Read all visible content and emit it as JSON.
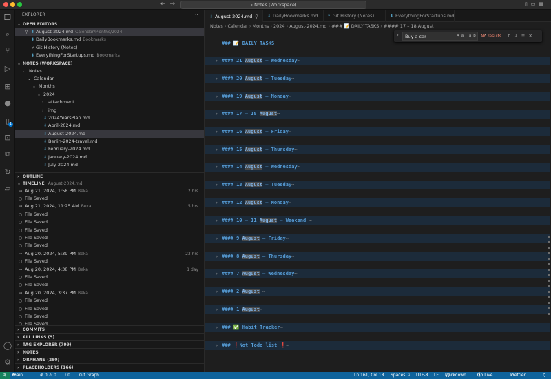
{
  "window": {
    "title": "Notes (Workspace)"
  },
  "explorer": {
    "title": "EXPLORER",
    "open_editors": {
      "label": "OPEN EDITORS",
      "items": [
        {
          "name": "August-2024.md",
          "desc": "Calendar/Months/2024"
        },
        {
          "name": "DailyBookmarks.md",
          "desc": "Bookmarks"
        },
        {
          "name": "Git History (Notes)",
          "desc": ""
        },
        {
          "name": "EverythingForStartups.md",
          "desc": "Bookmarks"
        }
      ]
    },
    "workspace": {
      "label": "NOTES (WORKSPACE)",
      "tree": [
        {
          "name": "Notes",
          "indent": 1,
          "kind": "folder-open"
        },
        {
          "name": "Calendar",
          "indent": 2,
          "kind": "folder-open"
        },
        {
          "name": "Months",
          "indent": 3,
          "kind": "folder-open"
        },
        {
          "name": "2024",
          "indent": 4,
          "kind": "folder-open"
        },
        {
          "name": "attachment",
          "indent": 5,
          "kind": "folder"
        },
        {
          "name": "img",
          "indent": 5,
          "kind": "folder"
        },
        {
          "name": "2024YearsPlan.md",
          "indent": 5,
          "kind": "file"
        },
        {
          "name": "April-2024.md",
          "indent": 5,
          "kind": "file"
        },
        {
          "name": "August-2024.md",
          "indent": 5,
          "kind": "file",
          "selected": true
        },
        {
          "name": "Berlin-2024-travel.md",
          "indent": 5,
          "kind": "file"
        },
        {
          "name": "February-2024.md",
          "indent": 5,
          "kind": "file"
        },
        {
          "name": "January-2024.md",
          "indent": 5,
          "kind": "file"
        },
        {
          "name": "July-2024.md",
          "indent": 5,
          "kind": "file"
        }
      ]
    },
    "outline_label": "OUTLINE",
    "timeline": {
      "label": "TIMELINE",
      "file": "August-2024.md",
      "items": [
        {
          "text": "Aug 21, 2024, 1:58 PM",
          "who": "Beka",
          "ago": "2 hrs",
          "commit": true
        },
        {
          "text": "File Saved",
          "who": "",
          "ago": "",
          "commit": false
        },
        {
          "text": "Aug 21, 2024, 11:25 AM",
          "who": "Beka",
          "ago": "5 hrs",
          "commit": true
        },
        {
          "text": "File Saved",
          "who": "",
          "ago": "",
          "commit": false
        },
        {
          "text": "File Saved",
          "who": "",
          "ago": "",
          "commit": false
        },
        {
          "text": "File Saved",
          "who": "",
          "ago": "",
          "commit": false
        },
        {
          "text": "File Saved",
          "who": "",
          "ago": "",
          "commit": false
        },
        {
          "text": "File Saved",
          "who": "",
          "ago": "",
          "commit": false
        },
        {
          "text": "Aug 20, 2024, 5:39 PM",
          "who": "Beka",
          "ago": "23 hrs",
          "commit": true
        },
        {
          "text": "File Saved",
          "who": "",
          "ago": "",
          "commit": false
        },
        {
          "text": "Aug 20, 2024, 4:38 PM",
          "who": "Beka",
          "ago": "1 day",
          "commit": true
        },
        {
          "text": "File Saved",
          "who": "",
          "ago": "",
          "commit": false
        },
        {
          "text": "File Saved",
          "who": "",
          "ago": "",
          "commit": false
        },
        {
          "text": "Aug 20, 2024, 3:37 PM",
          "who": "Beka",
          "ago": "",
          "commit": true
        },
        {
          "text": "File Saved",
          "who": "",
          "ago": "",
          "commit": false
        },
        {
          "text": "File Saved",
          "who": "",
          "ago": "",
          "commit": false
        },
        {
          "text": "File Saved",
          "who": "",
          "ago": "",
          "commit": false
        },
        {
          "text": "File Saved",
          "who": "",
          "ago": "",
          "commit": false
        }
      ]
    },
    "bottom_sections": [
      "COMMITS",
      "ALL LINKS (5)",
      "TAG EXPLORER (799)",
      "NOTES",
      "ORPHANS (280)",
      "PLACEHOLDERS (166)"
    ]
  },
  "tabs": [
    {
      "label": "August-2024.md",
      "active": true,
      "pinned": true
    },
    {
      "label": "DailyBookmarks.md",
      "active": false
    },
    {
      "label": "Git History (Notes)",
      "active": false
    },
    {
      "label": "EverythingForStartups.md",
      "active": false
    }
  ],
  "breadcrumb": {
    "parts": [
      "Notes",
      "Calendar",
      "Months",
      "2024",
      "August-2024.md",
      "### 📝 DAILY TASKS",
      "#### 17 – 18 August"
    ]
  },
  "find": {
    "value": "Buy a car",
    "options": "Aa ab .*",
    "results": "No results"
  },
  "editor": {
    "lines": [
      {
        "kind": "h3",
        "pre": "### 📝 ",
        "hl": "",
        "post": "DAILY TASKS",
        "folded": false
      },
      {
        "kind": "h4",
        "pre": "#### 21 ",
        "hl": "August",
        "post": " – Wednesday",
        "folded": true
      },
      {
        "kind": "h4",
        "pre": "#### 20 ",
        "hl": "August",
        "post": " – Tuesday",
        "folded": true
      },
      {
        "kind": "h4",
        "pre": "#### 19 ",
        "hl": "August",
        "post": " – Monday",
        "folded": true
      },
      {
        "kind": "h4",
        "pre": "#### 17 – 18 ",
        "hl": "August",
        "post": "",
        "folded": true
      },
      {
        "kind": "h4",
        "pre": "#### 16 ",
        "hl": "August",
        "post": " – Friday",
        "folded": true
      },
      {
        "kind": "h4",
        "pre": "#### 15 ",
        "hl": "August",
        "post": " – Thursday",
        "folded": true
      },
      {
        "kind": "h4",
        "pre": "#### 14 ",
        "hl": "August",
        "post": " – Wednesday",
        "folded": true
      },
      {
        "kind": "h4",
        "pre": "#### 13 ",
        "hl": "August",
        "post": " – Tuesday",
        "folded": true
      },
      {
        "kind": "h4",
        "pre": "#### 12 ",
        "hl": "August",
        "post": " – Monday",
        "folded": true
      },
      {
        "kind": "h4",
        "pre": "#### 10 – 11 ",
        "hl": "August",
        "post": " – Weekend ",
        "folded": true
      },
      {
        "kind": "h4",
        "pre": "#### 9 ",
        "hl": "August",
        "post": " – Friday",
        "folded": true
      },
      {
        "kind": "h4",
        "pre": "#### 8 ",
        "hl": "August",
        "post": " – Thursday",
        "folded": true
      },
      {
        "kind": "h4",
        "pre": "#### 7 ",
        "hl": "August",
        "post": " – Wednesday",
        "folded": true
      },
      {
        "kind": "h4",
        "pre": "#### 2 ",
        "hl": "August",
        "post": " ",
        "folded": true
      },
      {
        "kind": "h4",
        "pre": "#### 1 ",
        "hl": "August",
        "post": "",
        "folded": true
      },
      {
        "kind": "h3",
        "pre": "### ✅ ",
        "hl": "",
        "post": "Habit Tracker",
        "folded": true
      },
      {
        "kind": "h3",
        "pre": "### ",
        "hl": "",
        "post": "Not Todo list ",
        "folded": true,
        "redx": true
      }
    ]
  },
  "status": {
    "branch": "main",
    "problems": "⊗ 0 ⚠ 0",
    "ports": "⟟ 0",
    "gitgraph": "Git Graph",
    "position": "Ln 161, Col 18",
    "spaces": "Spaces: 2",
    "encoding": "UTF-8",
    "eol": "LF",
    "language": "Markdown",
    "golive": "Go Live",
    "prettier": "Prettier"
  },
  "colors": {
    "accent": "#0078d4",
    "status_bar": "#0e639c",
    "heading": "#569cd6",
    "fold_bg": "#1c2b3a"
  }
}
